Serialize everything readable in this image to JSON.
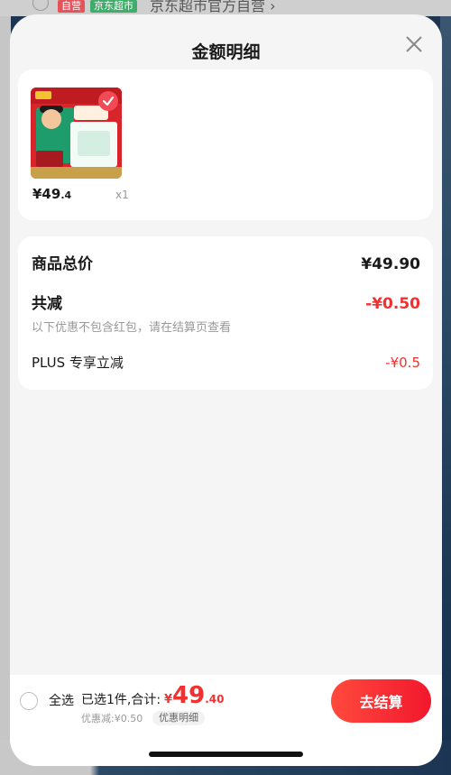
{
  "background": {
    "tag_self_run": "自营",
    "tag_market": "京东超市",
    "shop_name": "京东超市官方自营 ›"
  },
  "modal": {
    "title": "金额明细",
    "product": {
      "price_main": "¥49",
      "price_cents": ".4",
      "quantity": "x1"
    },
    "summary": {
      "total_label": "商品总价",
      "total_value": "¥49.90",
      "reduction_label": "共减",
      "reduction_value": "-¥0.50",
      "reduction_note": "以下优惠不包含红包，请在结算页查看",
      "plus_label": "PLUS 专享立减",
      "plus_value": "-¥0.5"
    },
    "bottom_bar": {
      "select_all": "全选",
      "selected_text": "已选1件,合计:",
      "total_currency": "¥",
      "total_int": "49",
      "total_dec": ".40",
      "discount_text": "优惠减:¥0.50",
      "detail_chip": "优惠明细",
      "checkout_label": "去结算"
    }
  },
  "colors": {
    "accent_red": "#f23030",
    "checkout_gradient_start": "#ff4a3d",
    "checkout_gradient_end": "#f2172d"
  },
  "icons": {
    "close": "close-icon",
    "check": "check-icon"
  }
}
